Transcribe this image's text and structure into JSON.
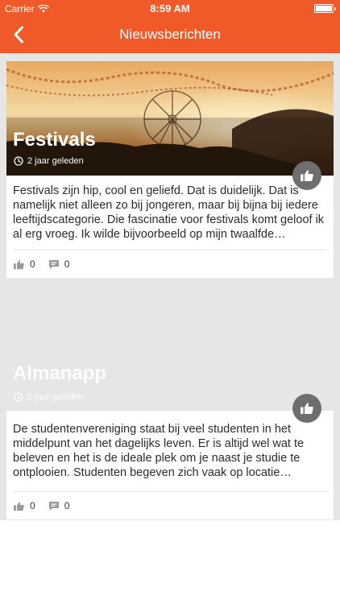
{
  "status_bar": {
    "carrier": "Carrier",
    "time": "8:59 AM"
  },
  "nav": {
    "title": "Nieuwsberichten",
    "back_icon": "chevron-left-icon"
  },
  "colors": {
    "accent": "#f05a28",
    "background": "#e6e6e6",
    "fab": "#6e6e6e"
  },
  "articles": [
    {
      "title": "Festivals",
      "time_ago": "2 jaar geleden",
      "excerpt": "Festivals zijn hip, cool en geliefd. Dat is duidelijk. Dat is namelijk niet alleen zo bij jongeren, maar bij bijna bij iedere leeftijdscategorie. Die fascinatie voor festivals komt geloof ik al erg vroeg. Ik wilde bijvoorbeeld op mijn twaalfde…",
      "likes": "0",
      "comments": "0"
    },
    {
      "title": "Almanapp",
      "time_ago": "2 jaar geleden",
      "excerpt": "De studentenvereniging staat bij veel studenten in het middelpunt van het dagelijks leven. Er is altijd wel wat te beleven en het is de ideale plek om je naast je studie te ontplooien. Studenten begeven zich vaak op locatie…",
      "likes": "0",
      "comments": "0"
    }
  ]
}
